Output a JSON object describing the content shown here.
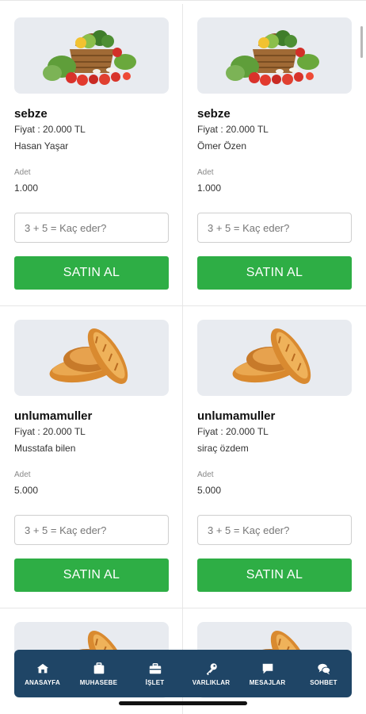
{
  "products": [
    {
      "title": "sebze",
      "price": "Fiyat : 20.000 TL",
      "seller": "Hasan Yaşar",
      "qty_label": "Adet",
      "qty": "1.000",
      "captcha_placeholder": "3 + 5 = Kaç eder?",
      "buy_label": "SATIN AL",
      "image": "vegetable-basket"
    },
    {
      "title": "sebze",
      "price": "Fiyat : 20.000 TL",
      "seller": "Ömer Özen",
      "qty_label": "Adet",
      "qty": "1.000",
      "captcha_placeholder": "3 + 5 = Kaç eder?",
      "buy_label": "SATIN AL",
      "image": "vegetable-basket"
    },
    {
      "title": "unlumamuller",
      "price": "Fiyat : 20.000 TL",
      "seller": "Musstafa bilen",
      "qty_label": "Adet",
      "qty": "5.000",
      "captcha_placeholder": "3 + 5 = Kaç eder?",
      "buy_label": "SATIN AL",
      "image": "bread"
    },
    {
      "title": "unlumamuller",
      "price": "Fiyat : 20.000 TL",
      "seller": "siraç özdem",
      "qty_label": "Adet",
      "qty": "5.000",
      "captcha_placeholder": "3 + 5 = Kaç eder?",
      "buy_label": "SATIN AL",
      "image": "bread"
    },
    {
      "image": "bread"
    },
    {
      "image": "bread"
    }
  ],
  "colors": {
    "buy_button": "#2eae45",
    "nav_background": "#1f4566",
    "image_background": "#e8ebf0"
  },
  "bottom_nav": {
    "items": [
      {
        "label": "ANASAYFA",
        "icon": "home-icon"
      },
      {
        "label": "MUHASEBE",
        "icon": "briefcase-icon"
      },
      {
        "label": "İŞLET",
        "icon": "suitcase-icon"
      },
      {
        "label": "VARLIKLAR",
        "icon": "key-icon"
      },
      {
        "label": "MESAJLAR",
        "icon": "message-icon"
      },
      {
        "label": "SOHBET",
        "icon": "chat-bubbles-icon"
      }
    ]
  }
}
